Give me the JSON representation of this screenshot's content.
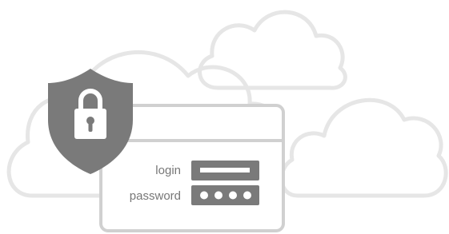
{
  "illustration": {
    "login_label": "login",
    "password_label": "password",
    "password_mask": "●●●●",
    "colors": {
      "cloud_stroke": "#e6e6e6",
      "shield_fill": "#7a7a7a",
      "padlock_fill": "#ffffff",
      "window_stroke": "#d0d0d0",
      "field_fill": "#7a7a7a",
      "label_color": "#777777"
    },
    "icons": [
      "cloud-icon",
      "shield-icon",
      "padlock-icon"
    ]
  }
}
